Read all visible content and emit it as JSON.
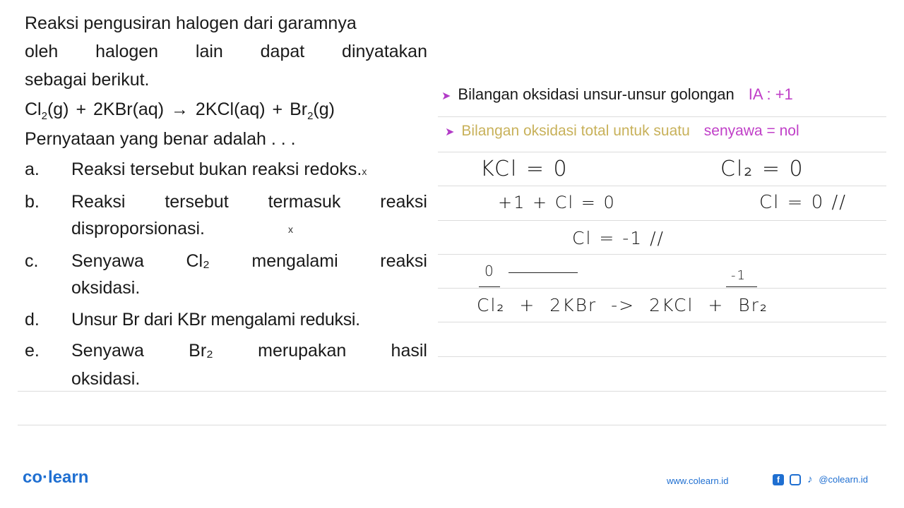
{
  "question": {
    "intro_line1": "Reaksi pengusiran halogen dari garamnya",
    "intro_line2_words": [
      "oleh",
      "halogen",
      "lain",
      "dapat",
      "dinyatakan"
    ],
    "intro_line3": "sebagai berikut.",
    "equation": {
      "p1": "Cl",
      "s1": "2",
      "p2": "(g) + 2KBr(aq) → 2KCl(aq) + Br",
      "s2": "2",
      "p3": "(g)"
    },
    "prompt": "Pernyataan yang benar adalah . . .",
    "options": [
      {
        "letter": "a.",
        "text": "Reaksi tersebut bukan reaksi redoks.",
        "mark": "x"
      },
      {
        "letter": "b.",
        "line1_words": [
          "Reaksi",
          "tersebut",
          "termasuk",
          "reaksi"
        ],
        "line2": "disproporsionasi.",
        "mark": "x"
      },
      {
        "letter": "c.",
        "line1_words": [
          "Senyawa",
          "Cl₂",
          "mengalami",
          "reaksi"
        ],
        "line2": "oksidasi."
      },
      {
        "letter": "d.",
        "text": "Unsur Br dari KBr mengalami reduksi."
      },
      {
        "letter": "e.",
        "line1_words": [
          "Senyawa",
          "Br₂",
          "merupakan",
          "hasil"
        ],
        "line2": "oksidasi."
      }
    ]
  },
  "notes": {
    "rule1": {
      "text": "Bilangan oksidasi unsur-unsur golongan",
      "highlight": "IA : +1"
    },
    "rule2": {
      "text": "Bilangan oksidasi total untuk suatu",
      "highlight": "senyawa = nol"
    },
    "handwriting": {
      "kcl": "KCl = 0",
      "cl2": "Cl₂ = 0",
      "sum": "+1 + Cl = 0",
      "cl_zero": "Cl = 0 //",
      "cl_neg": "Cl = -1 //",
      "ox_zero": "0",
      "ox_neg": "-1",
      "reaction": "Cl₂  +  2KBr  ->  2KCl  +  Br₂"
    }
  },
  "colors": {
    "arrow": "#b23bc7",
    "highlight": "#c040c8",
    "rule2_text": "#c8b15a",
    "brand": "#1f6fd1"
  },
  "footer": {
    "logo": "co·learn",
    "website": "www.colearn.id",
    "handle": "@colearn.id",
    "icons": [
      "facebook-icon",
      "instagram-icon",
      "tiktok-icon"
    ]
  }
}
